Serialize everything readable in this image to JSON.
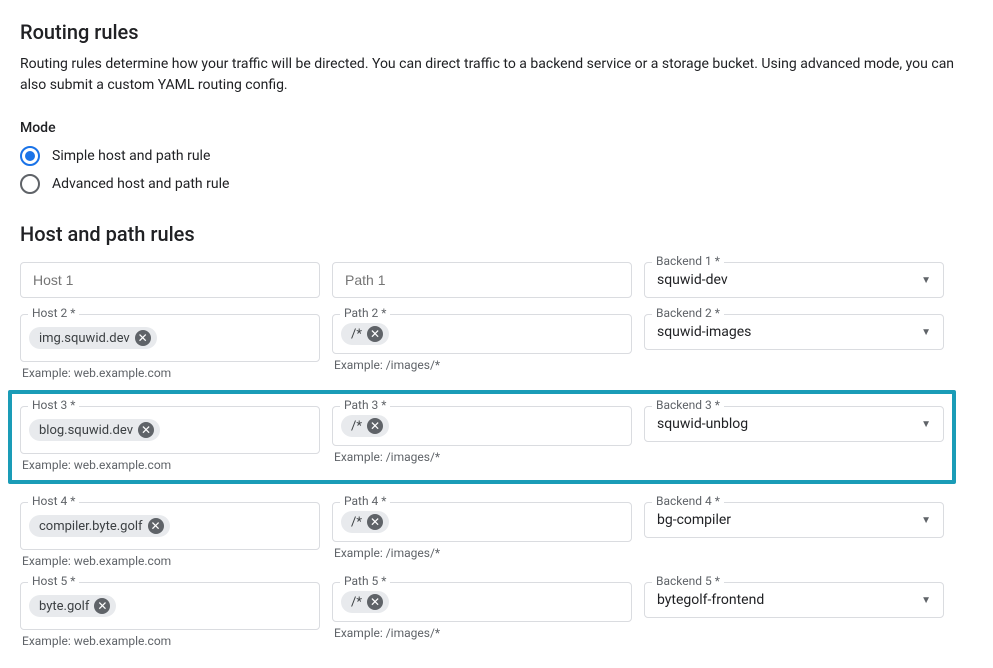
{
  "title": "Routing rules",
  "description": "Routing rules determine how your traffic will be directed. You can direct traffic to a backend service or a storage bucket. Using advanced mode, you can also submit a custom YAML routing config.",
  "mode": {
    "label": "Mode",
    "options": {
      "simple": "Simple host and path rule",
      "advanced": "Advanced host and path rule"
    }
  },
  "rules_title": "Host and path rules",
  "helpers": {
    "host": "Example: web.example.com",
    "path": "Example: /images/*"
  },
  "rows": [
    {
      "host": {
        "label": "",
        "placeholder": "Host 1",
        "chip": ""
      },
      "path": {
        "label": "",
        "placeholder": "Path 1",
        "chip": ""
      },
      "backend": {
        "label": "Backend 1 *",
        "value": "squwid-dev"
      }
    },
    {
      "host": {
        "label": "Host 2 *",
        "chip": "img.squwid.dev"
      },
      "path": {
        "label": "Path 2 *",
        "chip": "/*"
      },
      "backend": {
        "label": "Backend 2 *",
        "value": "squwid-images"
      }
    },
    {
      "host": {
        "label": "Host 3 *",
        "chip": "blog.squwid.dev"
      },
      "path": {
        "label": "Path 3 *",
        "chip": "/*"
      },
      "backend": {
        "label": "Backend 3 *",
        "value": "squwid-unblog"
      }
    },
    {
      "host": {
        "label": "Host 4 *",
        "chip": "compiler.byte.golf"
      },
      "path": {
        "label": "Path 4 *",
        "chip": "/*"
      },
      "backend": {
        "label": "Backend 4 *",
        "value": "bg-compiler"
      }
    },
    {
      "host": {
        "label": "Host 5 *",
        "chip": "byte.golf"
      },
      "path": {
        "label": "Path 5 *",
        "chip": "/*"
      },
      "backend": {
        "label": "Backend 5 *",
        "value": "bytegolf-frontend"
      }
    }
  ]
}
